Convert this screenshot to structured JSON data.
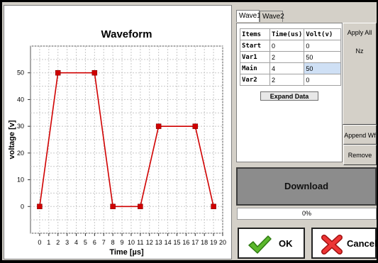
{
  "chart_data": {
    "type": "line",
    "title": "Waveform",
    "xlabel": "Time [µs]",
    "ylabel": "voltage [v]",
    "xlim": [
      -1,
      20
    ],
    "ylim": [
      -10,
      60
    ],
    "xticks": [
      "0",
      "1",
      "2",
      "3",
      "4",
      "5",
      "6",
      "7",
      "8",
      "9",
      "10",
      "11",
      "12",
      "13",
      "14",
      "15",
      "16",
      "17",
      "18",
      "19",
      "20"
    ],
    "yticks": [
      "0",
      "10",
      "20",
      "30",
      "40",
      "50"
    ],
    "grid": true,
    "color": "#d00000",
    "series": [
      {
        "x": [
          0,
          2,
          6,
          8,
          11,
          13,
          17,
          19
        ],
        "y": [
          0,
          50,
          50,
          0,
          0,
          30,
          30,
          0
        ]
      }
    ]
  },
  "tabs": [
    {
      "label": "Wave1"
    },
    {
      "label": "Wave2"
    }
  ],
  "table": {
    "headers": [
      "Items",
      "Time(us)",
      "Volt(v)"
    ],
    "rows": [
      [
        "Start",
        "0",
        "0"
      ],
      [
        "Var1",
        "2",
        "50"
      ],
      [
        "Main",
        "4",
        "50"
      ],
      [
        "Var2",
        "2",
        "0"
      ]
    ]
  },
  "buttons": {
    "expand": "Expand Data",
    "apply": "Apply  All Nz",
    "append": "Append Wf",
    "remove": "Remove Wf",
    "download": "Download",
    "ok": "OK",
    "cancel": "Cancel"
  },
  "progress": {
    "text": "0%",
    "value": 0
  }
}
